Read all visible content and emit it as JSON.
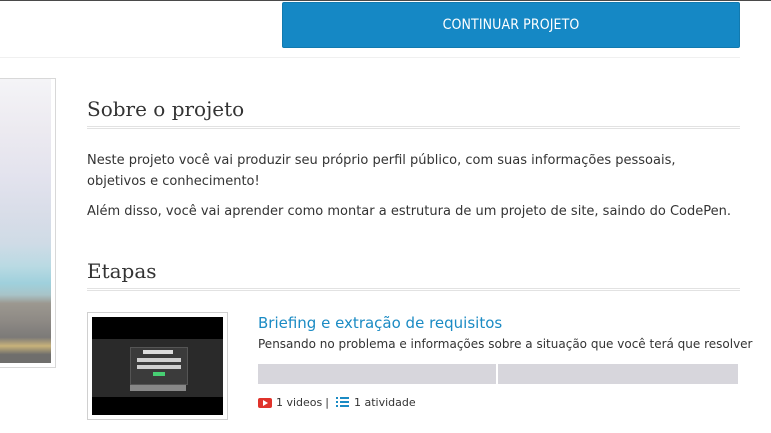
{
  "header": {
    "continue_button": "CONTINUAR PROJETO"
  },
  "about": {
    "title": "Sobre o projeto",
    "paragraphs": [
      "Neste projeto você vai produzir seu próprio perfil público, com suas informações pessoais, objetivos e conhecimento!",
      "Além disso, você vai aprender como montar a estrutura de um projeto de site, saindo do CodePen."
    ]
  },
  "steps": {
    "title": "Etapas",
    "items": [
      {
        "title": "Briefing e extração de requisitos",
        "description": "Pensando no problema e informações sobre a situação que você terá que resolver",
        "videos_label": "1 videos",
        "separator": "|",
        "activities_label": "1 atividade",
        "icons": [
          "video-icon",
          "list-icon"
        ]
      }
    ]
  },
  "colors": {
    "accent": "#1588c5",
    "link": "#1b8bc4",
    "progress_track": "#d7d6dc",
    "video_icon": "#e0332b"
  }
}
